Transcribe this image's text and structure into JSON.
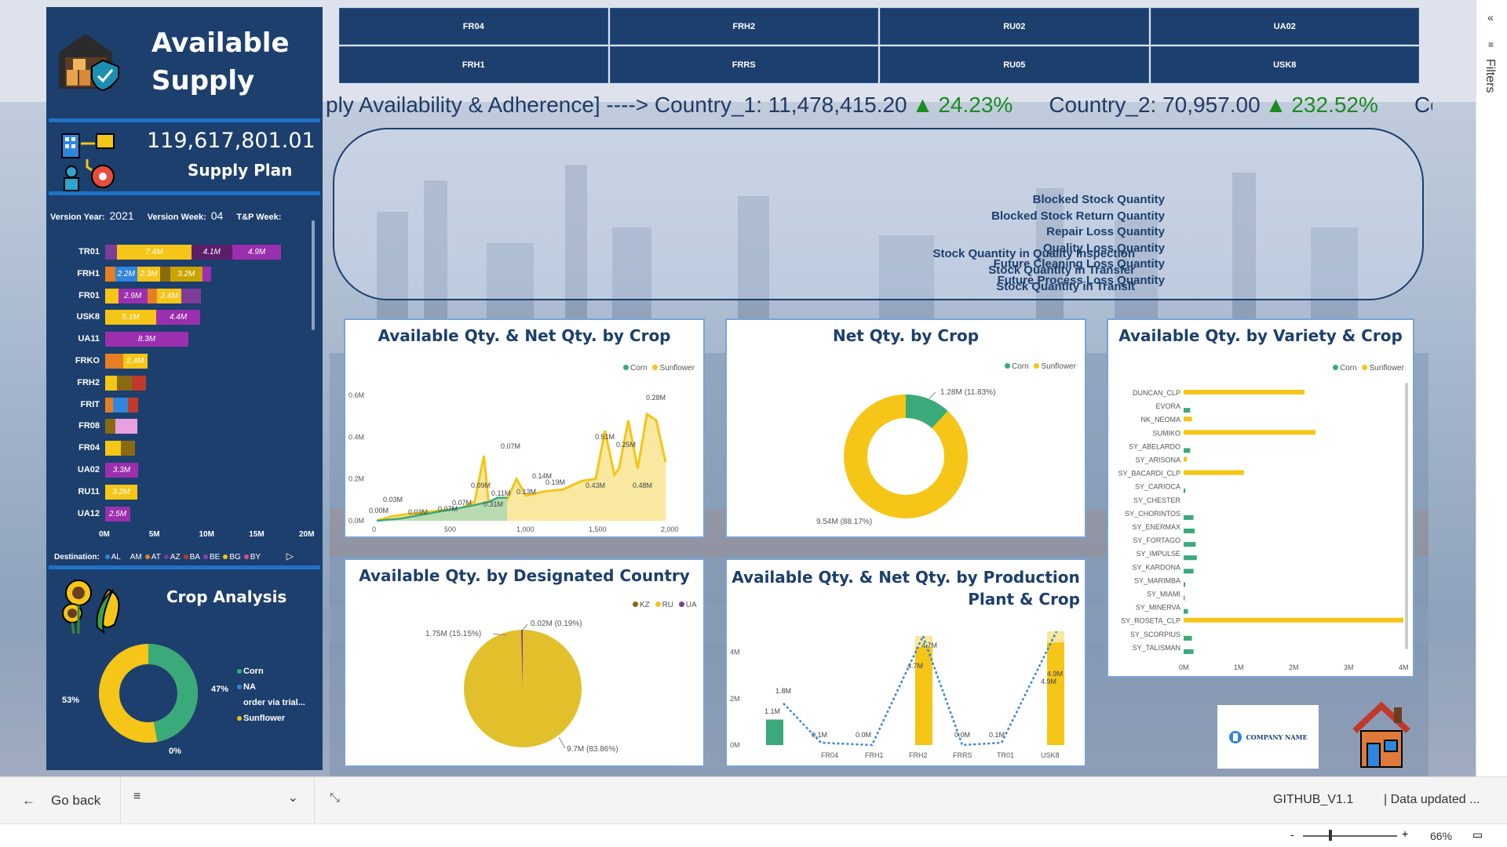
{
  "left_panel": {
    "title": "Available\nSupply",
    "title_line1": "Available",
    "title_line2": "Supply",
    "total": "119,617,801.01",
    "total_label": "Supply Plan",
    "version_year_label": "Version Year:",
    "version_year": "2021",
    "version_week_label": "Version Week:",
    "version_week": "04",
    "tp_week_label": "T&P Week:",
    "destination_label": "Destination:",
    "destinations": [
      {
        "name": "AL",
        "color": "#2e86de"
      },
      {
        "name": "AM",
        "color": "#1c3f6e"
      },
      {
        "name": "AT",
        "color": "#e67e22"
      },
      {
        "name": "AZ",
        "color": "#7d3c98"
      },
      {
        "name": "BA",
        "color": "#c0392b"
      },
      {
        "name": "BE",
        "color": "#8e44ad"
      },
      {
        "name": "BG",
        "color": "#f1c40f"
      },
      {
        "name": "BY",
        "color": "#e84393"
      }
    ],
    "crop_analysis_title": "Crop Analysis"
  },
  "plant_stack_chart": {
    "type": "bar",
    "orientation": "horizontal-stacked",
    "categories": [
      "TR01",
      "FRH1",
      "FR01",
      "USK8",
      "UA11",
      "FRKO",
      "FRH2",
      "FRIT",
      "FR08",
      "FR04",
      "UA02",
      "RU11",
      "UA12"
    ],
    "xlim": [
      0,
      20
    ],
    "x_ticks": [
      "0M",
      "5M",
      "10M",
      "15M",
      "20M"
    ],
    "data_labels": [
      {
        "plant": "TR01",
        "labels": [
          "7.4M",
          "4.1M",
          "4.9M"
        ]
      },
      {
        "plant": "FRH1",
        "labels": [
          "2.2M",
          "2.3M",
          "3.2M"
        ]
      },
      {
        "plant": "FR01",
        "labels": [
          "2.9M",
          "2.4M"
        ]
      },
      {
        "plant": "USK8",
        "labels": [
          "5.1M",
          "4.4M"
        ]
      },
      {
        "plant": "UA11",
        "labels": [
          "8.3M"
        ]
      },
      {
        "plant": "FRKO",
        "labels": [
          "2.4M"
        ]
      },
      {
        "plant": "UA02",
        "labels": [
          "3.3M"
        ]
      },
      {
        "plant": "RU11",
        "labels": [
          "3.2M"
        ]
      },
      {
        "plant": "UA12",
        "labels": [
          "2.5M"
        ]
      }
    ],
    "totals_millions": [
      16.9,
      10.6,
      9.6,
      9.5,
      8.3,
      4.2,
      4.1,
      3.3,
      3.2,
      3.0,
      3.3,
      3.2,
      2.5
    ]
  },
  "crop_donut": {
    "type": "pie",
    "labels": [
      "Corn",
      "NA",
      "order via trial...",
      "Sunflower"
    ],
    "legend_colors": [
      "#3aaa7a",
      "#2e86de",
      "#1c3f6e",
      "#f1c40f"
    ],
    "values_pct": [
      47,
      0,
      0,
      53
    ],
    "pct_labels": [
      "53%",
      "47%",
      "0%"
    ]
  },
  "plant_buttons": [
    "FR04",
    "FRH2",
    "RU02",
    "UA02",
    "FRH1",
    "FRRS",
    "RU05",
    "USK8"
  ],
  "ticker": {
    "prefix": "ply Availability & Adherence] ----> ",
    "items": [
      {
        "label": "Country_1: 11,478,415.20",
        "arrow": "▲",
        "change": "24.23%"
      },
      {
        "label": "Country_2: 70,957.00",
        "arrow": "▲",
        "change": "232.52%"
      },
      {
        "label": "Cou",
        "arrow": "",
        "change": ""
      }
    ]
  },
  "kpi_box": {
    "left_items": [
      "Stock Quantity in Quality Inspection",
      "Stock Quantity in Transfer",
      "Stock Quantity in Transit"
    ],
    "right_items": [
      "Blocked Stock Quantity",
      "Blocked Stock Return Quantity",
      "Repair Loss Quantity",
      "Quality Loss Quantity",
      "Future Cleaning Loss Quantity",
      "Future Process Loss Quantity"
    ]
  },
  "charts": {
    "area": {
      "title": "Available Qty. & Net Qty. by Crop",
      "legend": [
        "Corn",
        "Sunflower"
      ],
      "y_ticks": [
        "0.0M",
        "0.2M",
        "0.4M",
        "0.6M"
      ],
      "x_ticks": [
        "0",
        "500",
        "1,000",
        "1,500",
        "2,000"
      ],
      "labels": [
        "0.00M",
        "0.03M",
        "0.03M",
        "0.07M",
        "0.07M",
        "0.09M",
        "0.07M",
        "0.31M",
        "0.11M",
        "0.13M",
        "0.14M",
        "0.19M",
        "0.43M",
        "0.48M",
        "0.51M",
        "0.25M",
        "0.28M"
      ]
    },
    "net_donut": {
      "title": "Net Qty. by Crop",
      "legend": [
        "Corn",
        "Sunflower"
      ],
      "labels": [
        "1.28M (11.83%)",
        "9.54M (88.17%)"
      ]
    },
    "variety": {
      "title": "Available Qty. by Variety & Crop",
      "legend": [
        "Corn",
        "Sunflower"
      ],
      "x_ticks": [
        "0M",
        "1M",
        "2M",
        "3M",
        "4M"
      ],
      "varieties": [
        "DUNCAN_CLP",
        "EVORA",
        "NK_NEOMA",
        "SUMIKO",
        "SY_ABELARDO",
        "SY_ARISONA",
        "SY_BACARDI_CLP",
        "SY_CARIOCA",
        "SY_CHESTER",
        "SY_CHORINTOS",
        "SY_ENERMAX",
        "SY_FORTAGO",
        "SY_IMPULSE",
        "SY_KARDONA",
        "SY_MARIMBA",
        "SY_MIAMI",
        "SY_MINERVA",
        "SY_ROSETA_CLP",
        "SY_SCORPIUS",
        "SY_TALISMAN"
      ]
    },
    "country_pie": {
      "title": "Available Qty. by Designated Country",
      "legend": [
        "KZ",
        "RU",
        "UA"
      ],
      "labels": [
        "1.75M (15.15%)",
        "0.02M (0.19%)",
        "9.7M (83.86%)"
      ]
    },
    "production": {
      "title": "Available Qty. & Net Qty. by Production Plant & Crop",
      "title_line1": "Available Qty. & Net Qty. by Production",
      "title_line2": "Plant & Crop",
      "y_ticks": [
        "0M",
        "2M",
        "4M"
      ],
      "categories": [
        "FR04",
        "FRH1",
        "FRH2",
        "FRRS",
        "TR01",
        "USK8"
      ],
      "labels": [
        "1.1M",
        "1.8M",
        "0.1M",
        "0.0M",
        "4.7M",
        "4.7M",
        "0.0M",
        "0.1M",
        "4.9M",
        "4.9M"
      ]
    }
  },
  "company_logo": "COMPANY NAME",
  "filters_label": "Filters",
  "bottom_bar": {
    "go_back": "Go back",
    "report_name": "GITHUB_V1.1",
    "data_updated": "| Data updated ...",
    "zoom": "66%"
  },
  "colors": {
    "navy": "#1c3f6e",
    "corn": "#3aaa7a",
    "sunflower": "#f5c518",
    "accent_blue": "#1f72c7"
  }
}
